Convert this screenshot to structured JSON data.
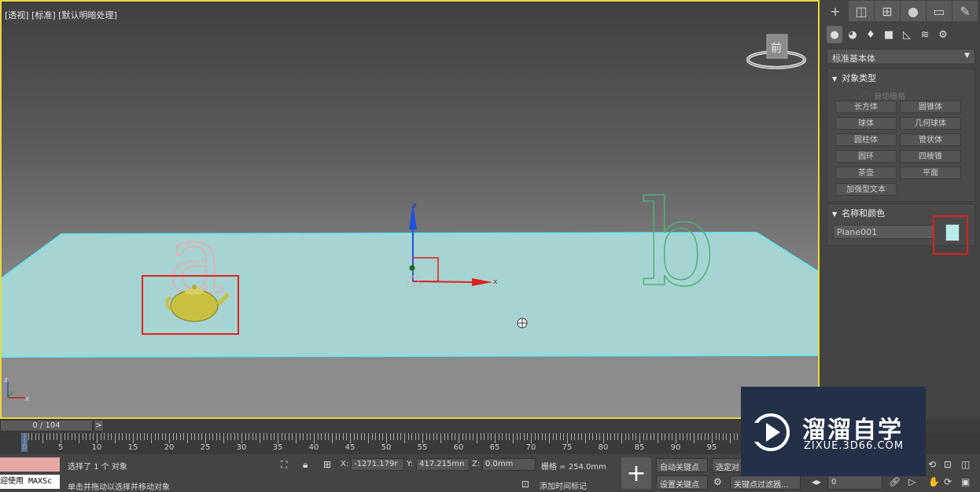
{
  "viewport": {
    "label": "[透视] [标准] [默认明暗处理]",
    "viewcube_label": "前",
    "letter_a": "a",
    "letter_b": "b",
    "gizmo_z": "z",
    "gizmo_x": "x",
    "axis_z": "z",
    "axis_x": "x"
  },
  "command_panel": {
    "tabs": [
      "plus-icon",
      "modify-icon",
      "hierarchy-icon",
      "motion-icon",
      "display-icon",
      "utilities-icon"
    ],
    "categories": [
      "geometry-icon",
      "shapes-icon",
      "lights-icon",
      "cameras-icon",
      "helpers-icon",
      "spacewarps-icon",
      "systems-icon"
    ],
    "dropdown": "标准基本体",
    "object_type": {
      "title": "对象类型",
      "autogrid": "自动栅格",
      "buttons": [
        "长方体",
        "圆锥体",
        "球体",
        "几何球体",
        "圆柱体",
        "管状体",
        "圆环",
        "四棱锥",
        "茶壶",
        "平面",
        "加强型文本"
      ]
    },
    "name_color": {
      "title": "名称和颜色",
      "name": "Plane001",
      "color": "#b8ecea"
    }
  },
  "timeline": {
    "slider": "0 / 104",
    "next": ">",
    "ticks": [
      "0",
      "5",
      "10",
      "15",
      "20",
      "25",
      "30",
      "35",
      "40",
      "45",
      "50",
      "55",
      "60",
      "65",
      "70",
      "75",
      "80",
      "85",
      "90",
      "95"
    ]
  },
  "status": {
    "listener_text": "迎使用 MAXSc",
    "selected": "选择了 1 个 对象",
    "prompt": "单击并拖动以选择并移动对象",
    "x_label": "X:",
    "x_value": "-1271.179r",
    "y_label": "Y:",
    "y_value": "417.215mn",
    "z_label": "Z:",
    "z_value": "0.0mm",
    "grid": "栅格 = 254.0mm",
    "add_time_tag": "添加时间标记",
    "auto_key": "自动关键点",
    "set_key": "设置关键点",
    "selected_obj": "选定对",
    "key_filters": "关键点过滤器...",
    "frame": "0"
  },
  "watermark": {
    "title": "溜溜自学",
    "subtitle": "ZIXUE.3D66.COM"
  },
  "colors": {
    "viewport_border": "#e8d83a",
    "plane": "#a6d4d2",
    "plane_edge": "#6fe6f0",
    "highlight": "#e02020",
    "teapot": "#c8c040"
  }
}
